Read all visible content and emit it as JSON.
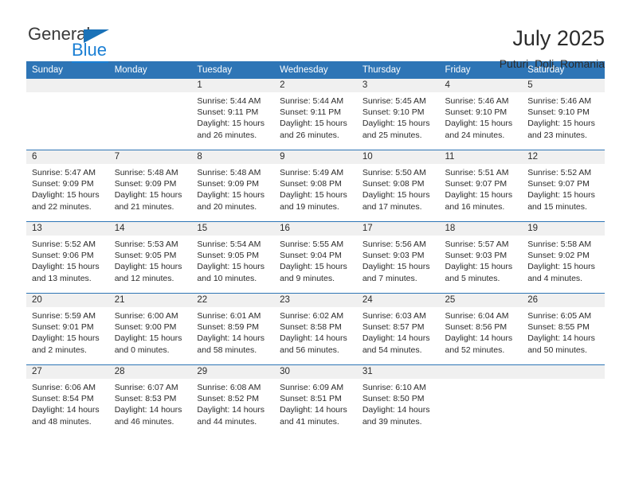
{
  "brand": {
    "name_part1": "General",
    "name_part2": "Blue",
    "logo_icon": "triangle-icon",
    "accent_color": "#1a7fd4"
  },
  "header": {
    "title": "July 2025",
    "subtitle": "Puturi, Dolj, Romania"
  },
  "theme": {
    "header_bar": "#2e75b6",
    "daynum_band": "#f0f0f0",
    "text": "#2b2b2b"
  },
  "weekday_headers": [
    "Sunday",
    "Monday",
    "Tuesday",
    "Wednesday",
    "Thursday",
    "Friday",
    "Saturday"
  ],
  "weeks": [
    [
      {
        "day": "",
        "lines": []
      },
      {
        "day": "",
        "lines": []
      },
      {
        "day": "1",
        "lines": [
          "Sunrise: 5:44 AM",
          "Sunset: 9:11 PM",
          "Daylight: 15 hours",
          "and 26 minutes."
        ]
      },
      {
        "day": "2",
        "lines": [
          "Sunrise: 5:44 AM",
          "Sunset: 9:11 PM",
          "Daylight: 15 hours",
          "and 26 minutes."
        ]
      },
      {
        "day": "3",
        "lines": [
          "Sunrise: 5:45 AM",
          "Sunset: 9:10 PM",
          "Daylight: 15 hours",
          "and 25 minutes."
        ]
      },
      {
        "day": "4",
        "lines": [
          "Sunrise: 5:46 AM",
          "Sunset: 9:10 PM",
          "Daylight: 15 hours",
          "and 24 minutes."
        ]
      },
      {
        "day": "5",
        "lines": [
          "Sunrise: 5:46 AM",
          "Sunset: 9:10 PM",
          "Daylight: 15 hours",
          "and 23 minutes."
        ]
      }
    ],
    [
      {
        "day": "6",
        "lines": [
          "Sunrise: 5:47 AM",
          "Sunset: 9:09 PM",
          "Daylight: 15 hours",
          "and 22 minutes."
        ]
      },
      {
        "day": "7",
        "lines": [
          "Sunrise: 5:48 AM",
          "Sunset: 9:09 PM",
          "Daylight: 15 hours",
          "and 21 minutes."
        ]
      },
      {
        "day": "8",
        "lines": [
          "Sunrise: 5:48 AM",
          "Sunset: 9:09 PM",
          "Daylight: 15 hours",
          "and 20 minutes."
        ]
      },
      {
        "day": "9",
        "lines": [
          "Sunrise: 5:49 AM",
          "Sunset: 9:08 PM",
          "Daylight: 15 hours",
          "and 19 minutes."
        ]
      },
      {
        "day": "10",
        "lines": [
          "Sunrise: 5:50 AM",
          "Sunset: 9:08 PM",
          "Daylight: 15 hours",
          "and 17 minutes."
        ]
      },
      {
        "day": "11",
        "lines": [
          "Sunrise: 5:51 AM",
          "Sunset: 9:07 PM",
          "Daylight: 15 hours",
          "and 16 minutes."
        ]
      },
      {
        "day": "12",
        "lines": [
          "Sunrise: 5:52 AM",
          "Sunset: 9:07 PM",
          "Daylight: 15 hours",
          "and 15 minutes."
        ]
      }
    ],
    [
      {
        "day": "13",
        "lines": [
          "Sunrise: 5:52 AM",
          "Sunset: 9:06 PM",
          "Daylight: 15 hours",
          "and 13 minutes."
        ]
      },
      {
        "day": "14",
        "lines": [
          "Sunrise: 5:53 AM",
          "Sunset: 9:05 PM",
          "Daylight: 15 hours",
          "and 12 minutes."
        ]
      },
      {
        "day": "15",
        "lines": [
          "Sunrise: 5:54 AM",
          "Sunset: 9:05 PM",
          "Daylight: 15 hours",
          "and 10 minutes."
        ]
      },
      {
        "day": "16",
        "lines": [
          "Sunrise: 5:55 AM",
          "Sunset: 9:04 PM",
          "Daylight: 15 hours",
          "and 9 minutes."
        ]
      },
      {
        "day": "17",
        "lines": [
          "Sunrise: 5:56 AM",
          "Sunset: 9:03 PM",
          "Daylight: 15 hours",
          "and 7 minutes."
        ]
      },
      {
        "day": "18",
        "lines": [
          "Sunrise: 5:57 AM",
          "Sunset: 9:03 PM",
          "Daylight: 15 hours",
          "and 5 minutes."
        ]
      },
      {
        "day": "19",
        "lines": [
          "Sunrise: 5:58 AM",
          "Sunset: 9:02 PM",
          "Daylight: 15 hours",
          "and 4 minutes."
        ]
      }
    ],
    [
      {
        "day": "20",
        "lines": [
          "Sunrise: 5:59 AM",
          "Sunset: 9:01 PM",
          "Daylight: 15 hours",
          "and 2 minutes."
        ]
      },
      {
        "day": "21",
        "lines": [
          "Sunrise: 6:00 AM",
          "Sunset: 9:00 PM",
          "Daylight: 15 hours",
          "and 0 minutes."
        ]
      },
      {
        "day": "22",
        "lines": [
          "Sunrise: 6:01 AM",
          "Sunset: 8:59 PM",
          "Daylight: 14 hours",
          "and 58 minutes."
        ]
      },
      {
        "day": "23",
        "lines": [
          "Sunrise: 6:02 AM",
          "Sunset: 8:58 PM",
          "Daylight: 14 hours",
          "and 56 minutes."
        ]
      },
      {
        "day": "24",
        "lines": [
          "Sunrise: 6:03 AM",
          "Sunset: 8:57 PM",
          "Daylight: 14 hours",
          "and 54 minutes."
        ]
      },
      {
        "day": "25",
        "lines": [
          "Sunrise: 6:04 AM",
          "Sunset: 8:56 PM",
          "Daylight: 14 hours",
          "and 52 minutes."
        ]
      },
      {
        "day": "26",
        "lines": [
          "Sunrise: 6:05 AM",
          "Sunset: 8:55 PM",
          "Daylight: 14 hours",
          "and 50 minutes."
        ]
      }
    ],
    [
      {
        "day": "27",
        "lines": [
          "Sunrise: 6:06 AM",
          "Sunset: 8:54 PM",
          "Daylight: 14 hours",
          "and 48 minutes."
        ]
      },
      {
        "day": "28",
        "lines": [
          "Sunrise: 6:07 AM",
          "Sunset: 8:53 PM",
          "Daylight: 14 hours",
          "and 46 minutes."
        ]
      },
      {
        "day": "29",
        "lines": [
          "Sunrise: 6:08 AM",
          "Sunset: 8:52 PM",
          "Daylight: 14 hours",
          "and 44 minutes."
        ]
      },
      {
        "day": "30",
        "lines": [
          "Sunrise: 6:09 AM",
          "Sunset: 8:51 PM",
          "Daylight: 14 hours",
          "and 41 minutes."
        ]
      },
      {
        "day": "31",
        "lines": [
          "Sunrise: 6:10 AM",
          "Sunset: 8:50 PM",
          "Daylight: 14 hours",
          "and 39 minutes."
        ]
      },
      {
        "day": "",
        "lines": []
      },
      {
        "day": "",
        "lines": []
      }
    ]
  ]
}
